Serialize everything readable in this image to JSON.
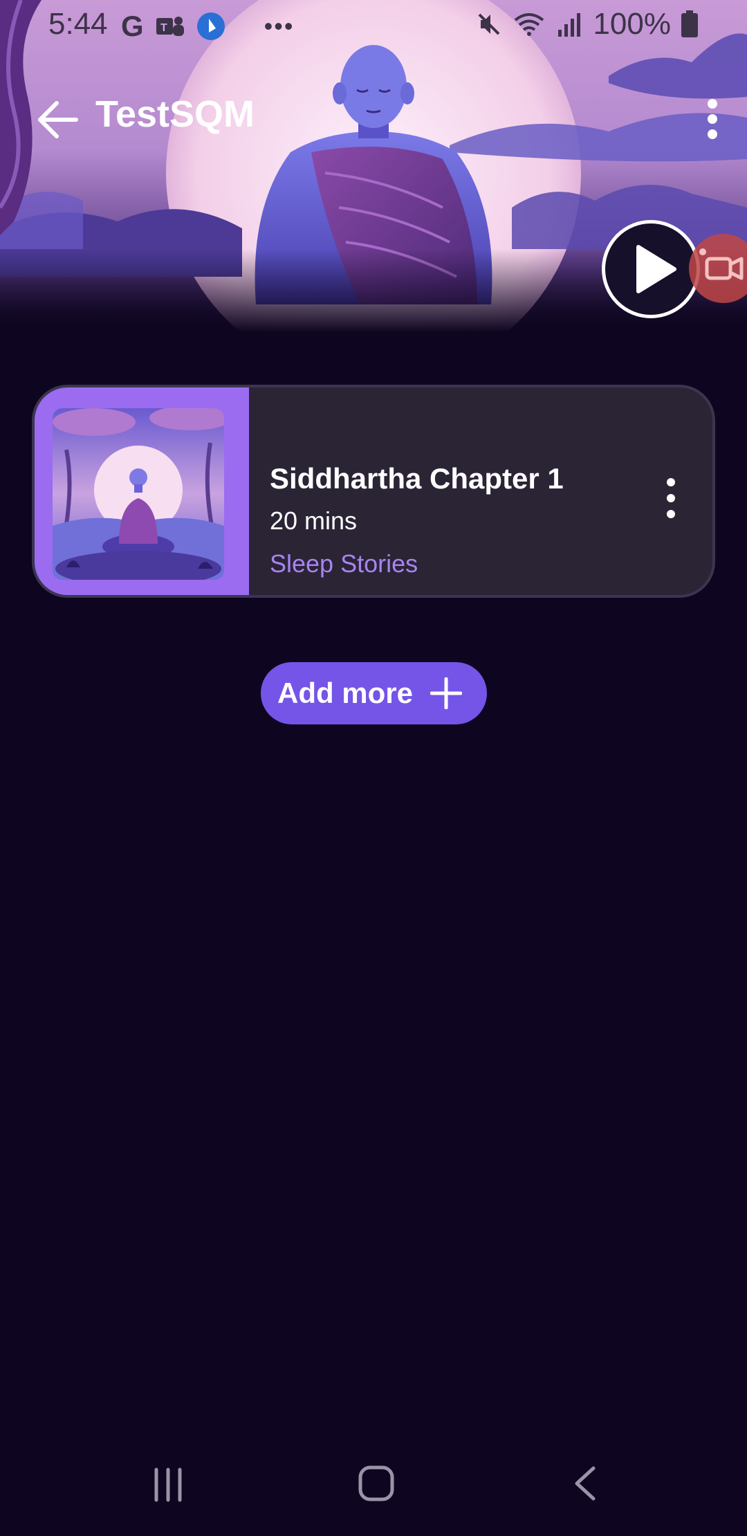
{
  "status_bar": {
    "time": "5:44",
    "battery": "100%",
    "icons": [
      "google-icon",
      "teams-icon",
      "app-icon",
      "more-notifications-icon",
      "mute-icon",
      "wifi-icon",
      "signal-icon",
      "battery-icon"
    ]
  },
  "header": {
    "title": "TestSQM"
  },
  "playlist": {
    "items": [
      {
        "title": "Siddhartha Chapter 1",
        "duration": "20 mins",
        "category": "Sleep Stories"
      }
    ]
  },
  "actions": {
    "add_more_label": "Add more"
  },
  "colors": {
    "background": "#0e0620",
    "card": "#2a2435",
    "thumb_panel": "#9b6cf0",
    "accent": "#7554e8",
    "category": "#a983f2"
  }
}
